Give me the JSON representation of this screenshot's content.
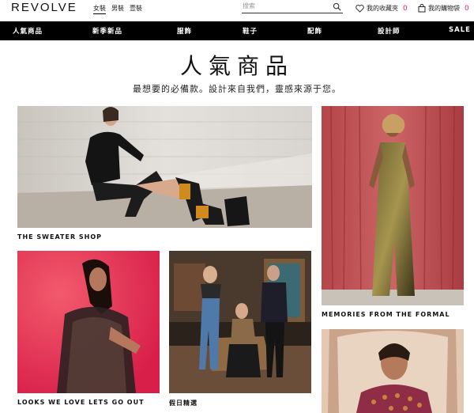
{
  "brand": {
    "logo": "REVOLVE"
  },
  "gender_tabs": [
    "女裝",
    "男裝",
    "壹裝"
  ],
  "search": {
    "placeholder": "搜索"
  },
  "wishlist": {
    "label": "我的收藏夾",
    "count": "0"
  },
  "bag": {
    "label": "我的購物袋",
    "count": "0"
  },
  "nav": [
    "人氣商品",
    "新季新品",
    "服飾",
    "鞋子",
    "配飾",
    "設計師",
    "SALE"
  ],
  "hero": {
    "title": "人氣商品",
    "subtitle": "最想要的必備款。設計來自我們，靈感來源于您。"
  },
  "tiles": [
    {
      "caption": "THE SWEATER SHOP"
    },
    {
      "caption": "MEMORIES FROM THE FORMAL"
    },
    {
      "caption": "LOOKS WE LOVE LETS GO OUT"
    },
    {
      "caption": "假日精選"
    },
    {
      "caption": ""
    }
  ],
  "colors": {
    "accent": "#e0197d",
    "nav_bg": "#000000"
  }
}
